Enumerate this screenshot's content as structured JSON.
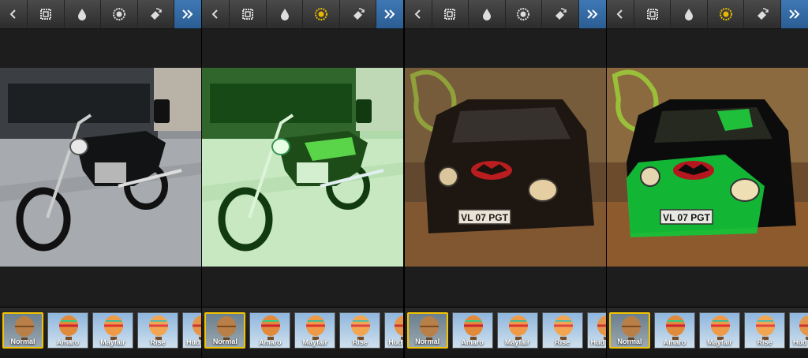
{
  "panels": [
    {
      "toolbar": {
        "icons": [
          "back-arrow-icon",
          "frame-icon",
          "blur-drop-icon",
          "lux-icon",
          "rotate-icon",
          "more-icon"
        ],
        "lux_active": false
      },
      "photo": {
        "subject": "motorcycle",
        "tint": "normal"
      },
      "filters": [
        {
          "label": "Normal",
          "selected": true
        },
        {
          "label": "Amaro",
          "selected": false
        },
        {
          "label": "Mayfair",
          "selected": false
        },
        {
          "label": "Rise",
          "selected": false
        },
        {
          "label": "Hud",
          "selected": false
        }
      ]
    },
    {
      "toolbar": {
        "icons": [
          "back-arrow-icon",
          "frame-icon",
          "blur-drop-icon",
          "lux-icon",
          "rotate-icon",
          "more-icon"
        ],
        "lux_active": true
      },
      "photo": {
        "subject": "motorcycle",
        "tint": "green"
      },
      "filters": [
        {
          "label": "Normal",
          "selected": true
        },
        {
          "label": "Amaro",
          "selected": false
        },
        {
          "label": "Mayfair",
          "selected": false
        },
        {
          "label": "Rise",
          "selected": false
        },
        {
          "label": "Hud",
          "selected": false
        }
      ]
    },
    {
      "toolbar": {
        "icons": [
          "back-arrow-icon",
          "frame-icon",
          "blur-drop-icon",
          "lux-icon",
          "rotate-icon",
          "more-icon"
        ],
        "lux_active": false
      },
      "photo": {
        "subject": "car",
        "tint": "normal",
        "plate": "VL 07 PGT"
      },
      "filters": [
        {
          "label": "Normal",
          "selected": true
        },
        {
          "label": "Amaro",
          "selected": false
        },
        {
          "label": "Mayfair",
          "selected": false
        },
        {
          "label": "Rise",
          "selected": false
        },
        {
          "label": "Hud",
          "selected": false
        }
      ]
    },
    {
      "toolbar": {
        "icons": [
          "back-arrow-icon",
          "frame-icon",
          "blur-drop-icon",
          "lux-icon",
          "rotate-icon",
          "more-icon"
        ],
        "lux_active": true
      },
      "photo": {
        "subject": "car",
        "tint": "green",
        "plate": "VL 07 PGT"
      },
      "filters": [
        {
          "label": "Normal",
          "selected": true
        },
        {
          "label": "Amaro",
          "selected": false
        },
        {
          "label": "Mayfair",
          "selected": false
        },
        {
          "label": "Rise",
          "selected": false
        },
        {
          "label": "Hud",
          "selected": false
        }
      ]
    }
  ],
  "colors": {
    "toolbar_bg": "#3a3a3a",
    "more_button": "#3572ad",
    "lux_active": "#e8b800",
    "selected_filter_border": "#f2c400",
    "background": "#1d1d1d"
  }
}
